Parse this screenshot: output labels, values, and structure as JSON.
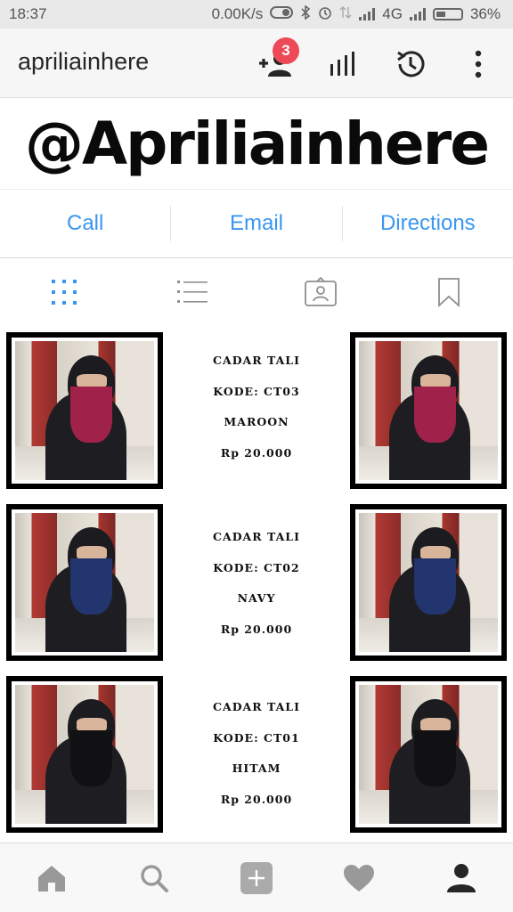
{
  "status_bar": {
    "time": "18:37",
    "speed": "0.00K/s",
    "network": "4G",
    "battery": "36%"
  },
  "app_bar": {
    "username": "apriliainhere",
    "notification_count": "3",
    "icons": [
      "add-user-icon",
      "bar-chart-icon",
      "history-icon",
      "more-vertical-icon"
    ]
  },
  "banner": {
    "text": "@Apriliainhere"
  },
  "contact": {
    "call": "Call",
    "email": "Email",
    "directions": "Directions"
  },
  "view_tabs": [
    "grid-icon",
    "list-icon",
    "tagged-icon",
    "bookmark-icon"
  ],
  "products": [
    {
      "name": "CADAR TALI",
      "code": "KODE: CT03",
      "color": "MAROON",
      "price": "Rp 20.000",
      "veil_hex": "#a0224a"
    },
    {
      "name": "CADAR TALI",
      "code": "KODE: CT02",
      "color": "NAVY",
      "price": "Rp 20.000",
      "veil_hex": "#22356e"
    },
    {
      "name": "CADAR TALI",
      "code": "KODE: CT01",
      "color": "HITAM",
      "price": "Rp 20.000",
      "veil_hex": "#111114"
    }
  ],
  "bottom_nav": [
    "home-icon",
    "search-icon",
    "add-post-icon",
    "heart-icon",
    "profile-icon"
  ],
  "colors": {
    "accent_blue": "#3897f0",
    "badge_red": "#ed4956",
    "tab_active": "#3897f0",
    "icon_gray": "#262626"
  }
}
